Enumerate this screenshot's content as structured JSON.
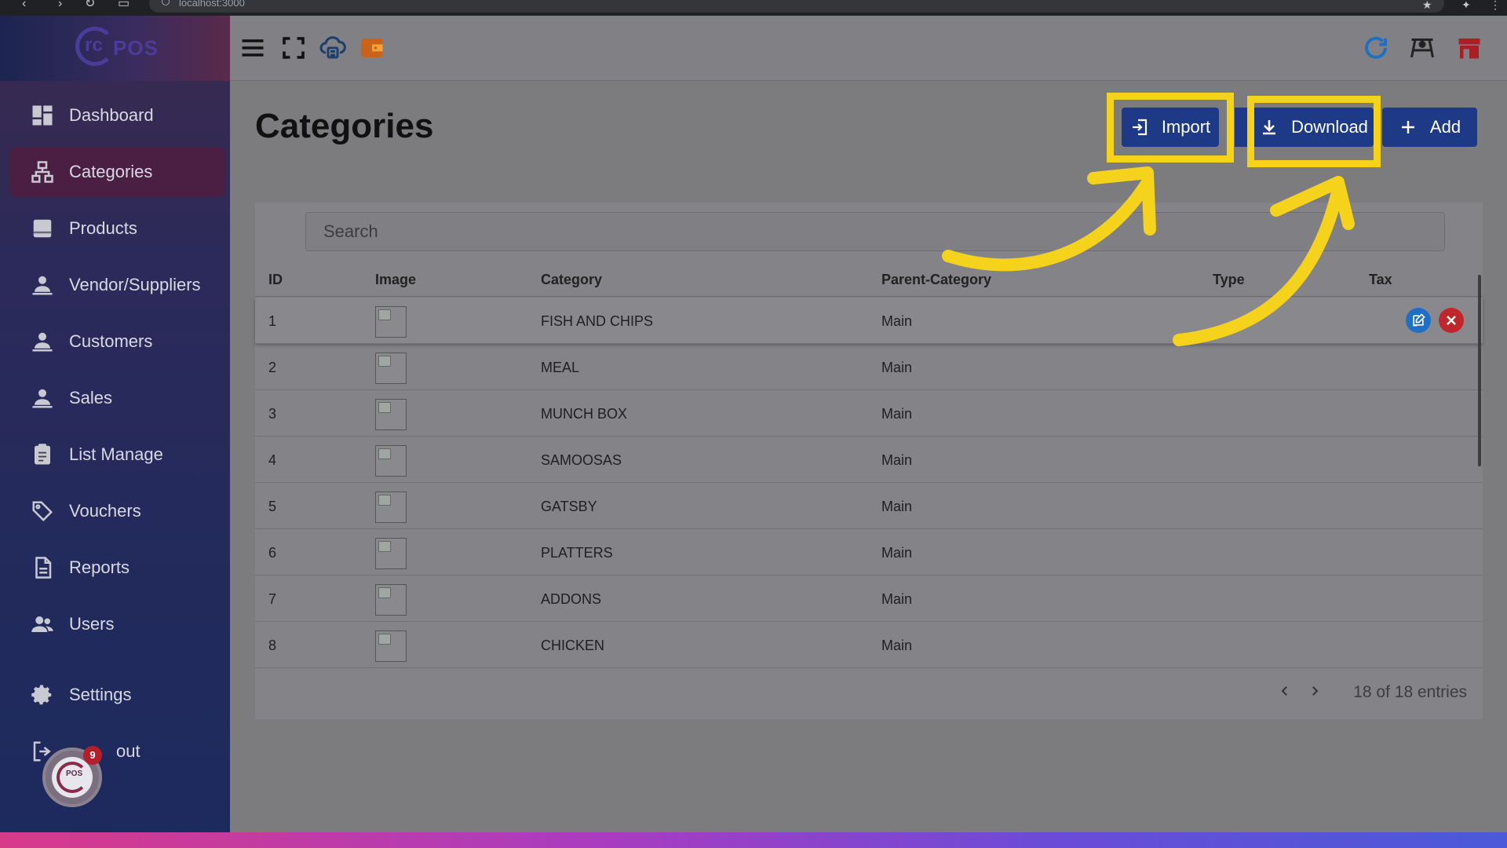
{
  "browser": {
    "url": "localhost:3000"
  },
  "sidebar": {
    "logo_text": "POS",
    "logo_mark": "rc",
    "items": [
      {
        "label": "Dashboard",
        "icon": "dashboard-icon"
      },
      {
        "label": "Categories",
        "icon": "sitemap-icon",
        "active": true
      },
      {
        "label": "Products",
        "icon": "product-box-icon"
      },
      {
        "label": "Vendor/Suppliers",
        "icon": "person-icon"
      },
      {
        "label": "Customers",
        "icon": "person-icon"
      },
      {
        "label": "Sales",
        "icon": "person-icon"
      },
      {
        "label": "List Manage",
        "icon": "clipboard-icon"
      },
      {
        "label": "Vouchers",
        "icon": "tag-icon"
      },
      {
        "label": "Reports",
        "icon": "document-icon"
      },
      {
        "label": "Users",
        "icon": "users-icon"
      },
      {
        "label": "Settings",
        "icon": "gear-icon"
      },
      {
        "label": "Logout",
        "visible_label": "out",
        "icon": "logout-icon"
      }
    ],
    "fab": {
      "badge": "9",
      "mark": "rc",
      "sub": "POS"
    }
  },
  "page": {
    "title": "Categories",
    "buttons": {
      "import": "Import",
      "download": "Download",
      "add": "Add"
    }
  },
  "search": {
    "placeholder": "Search"
  },
  "table": {
    "columns": [
      "ID",
      "Image",
      "Category",
      "Parent-Category",
      "Type",
      "Tax"
    ],
    "rows": [
      {
        "id": "1",
        "category": "FISH AND CHIPS",
        "parent": "Main"
      },
      {
        "id": "2",
        "category": "MEAL",
        "parent": "Main"
      },
      {
        "id": "3",
        "category": "MUNCH BOX",
        "parent": "Main"
      },
      {
        "id": "4",
        "category": "SAMOOSAS",
        "parent": "Main"
      },
      {
        "id": "5",
        "category": "GATSBY",
        "parent": "Main"
      },
      {
        "id": "6",
        "category": "PLATTERS",
        "parent": "Main"
      },
      {
        "id": "7",
        "category": "ADDONS",
        "parent": "Main"
      },
      {
        "id": "8",
        "category": "CHICKEN",
        "parent": "Main"
      }
    ],
    "entries_text": "18 of 18 entries"
  },
  "colors": {
    "primary_button": "#1e3a86",
    "highlight": "#f5d21b",
    "delete": "#c0272d",
    "edit": "#1f6fc4"
  }
}
